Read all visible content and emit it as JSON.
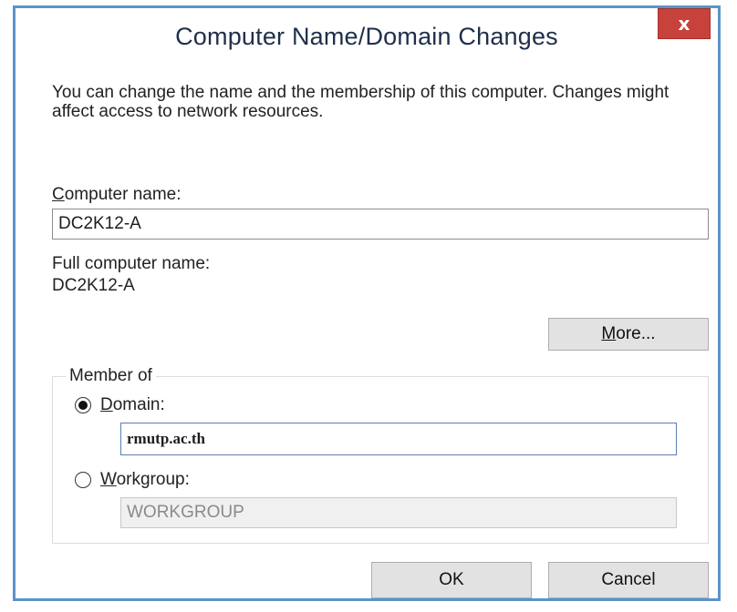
{
  "window": {
    "title": "Computer Name/Domain Changes",
    "close_label": "x"
  },
  "description": "You can change the name and the membership of this computer. Changes might affect access to network resources.",
  "computer_name": {
    "label_first": "C",
    "label_rest": "omputer name:",
    "value": "DC2K12-A"
  },
  "full_computer_name": {
    "label": "Full computer name:",
    "value": "DC2K12-A"
  },
  "more_button": {
    "label_first": "M",
    "label_rest": "ore..."
  },
  "member_of": {
    "legend": "Member of",
    "domain": {
      "label_first": "D",
      "label_rest": "omain:",
      "value": "rmutp.ac.th",
      "selected": true
    },
    "workgroup": {
      "label_first": "W",
      "label_rest": "orkgroup:",
      "value": "WORKGROUP",
      "selected": false
    }
  },
  "buttons": {
    "ok": "OK",
    "cancel": "Cancel"
  }
}
